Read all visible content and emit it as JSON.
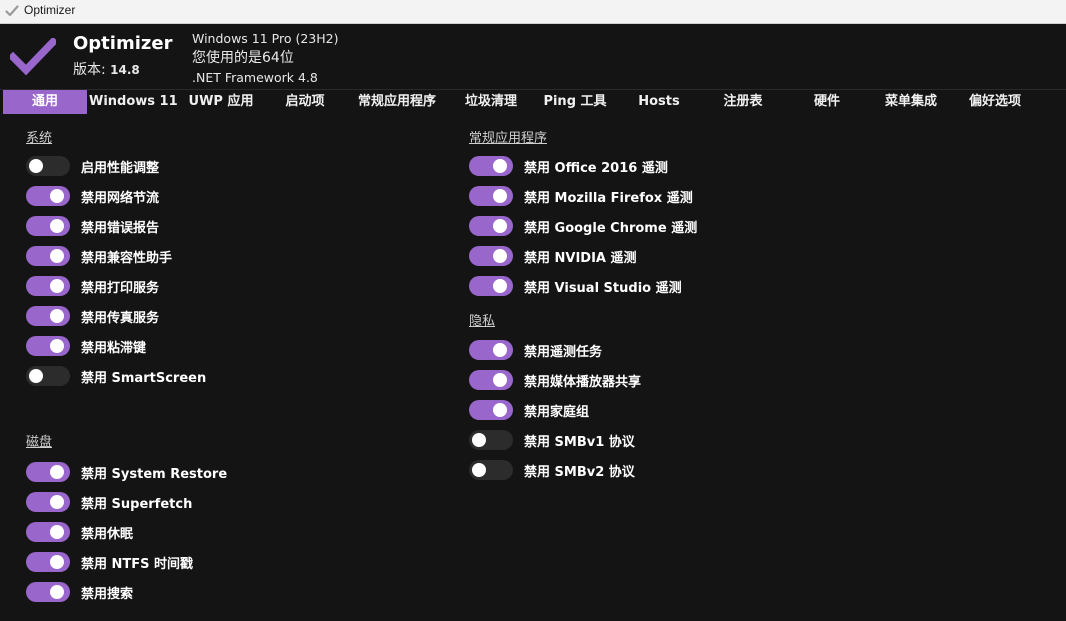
{
  "window": {
    "title": "Optimizer"
  },
  "header": {
    "app_name": "Optimizer",
    "version_label": "版本:",
    "version_value": "14.8",
    "os_info": "Windows 11 Pro (23H2)",
    "arch_info": "您使用的是64位",
    "framework_info": ".NET Framework 4.8"
  },
  "colors": {
    "accent": "#9966cc",
    "background": "#141414",
    "toggle_off": "#2c2c2c"
  },
  "tabs": [
    {
      "label": "通用",
      "active": true
    },
    {
      "label": "Windows 11",
      "active": false
    },
    {
      "label": "UWP 应用",
      "active": false
    },
    {
      "label": "启动项",
      "active": false
    },
    {
      "label": "常规应用程序",
      "active": false
    },
    {
      "label": "垃圾清理",
      "active": false
    },
    {
      "label": "Ping 工具",
      "active": false
    },
    {
      "label": "Hosts",
      "active": false
    },
    {
      "label": "注册表",
      "active": false
    },
    {
      "label": "硬件",
      "active": false
    },
    {
      "label": "菜单集成",
      "active": false
    },
    {
      "label": "偏好选项",
      "active": false
    }
  ],
  "sections": {
    "system": {
      "title": "系统",
      "items": [
        {
          "label": "启用性能调整",
          "on": false
        },
        {
          "label": "禁用网络节流",
          "on": true
        },
        {
          "label": "禁用错误报告",
          "on": true
        },
        {
          "label": "禁用兼容性助手",
          "on": true
        },
        {
          "label": "禁用打印服务",
          "on": true
        },
        {
          "label": "禁用传真服务",
          "on": true
        },
        {
          "label": "禁用粘滞键",
          "on": true
        },
        {
          "label": "禁用 SmartScreen",
          "on": false
        }
      ]
    },
    "disk": {
      "title": "磁盘",
      "items": [
        {
          "label": "禁用 System Restore",
          "on": true
        },
        {
          "label": "禁用 Superfetch",
          "on": true
        },
        {
          "label": "禁用休眠",
          "on": true
        },
        {
          "label": "禁用 NTFS 时间戳",
          "on": true
        },
        {
          "label": "禁用搜索",
          "on": true
        }
      ]
    },
    "apps": {
      "title": "常规应用程序",
      "items": [
        {
          "label": "禁用 Office 2016 遥测",
          "on": true
        },
        {
          "label": "禁用 Mozilla Firefox 遥测",
          "on": true
        },
        {
          "label": "禁用 Google Chrome 遥测",
          "on": true
        },
        {
          "label": "禁用 NVIDIA 遥测",
          "on": true
        },
        {
          "label": "禁用 Visual Studio 遥测",
          "on": true
        }
      ]
    },
    "privacy": {
      "title": "隐私",
      "items": [
        {
          "label": "禁用遥测任务",
          "on": true
        },
        {
          "label": "禁用媒体播放器共享",
          "on": true
        },
        {
          "label": "禁用家庭组",
          "on": true
        },
        {
          "label": "禁用 SMBv1 协议",
          "on": false
        },
        {
          "label": "禁用 SMBv2 协议",
          "on": false
        }
      ]
    }
  }
}
